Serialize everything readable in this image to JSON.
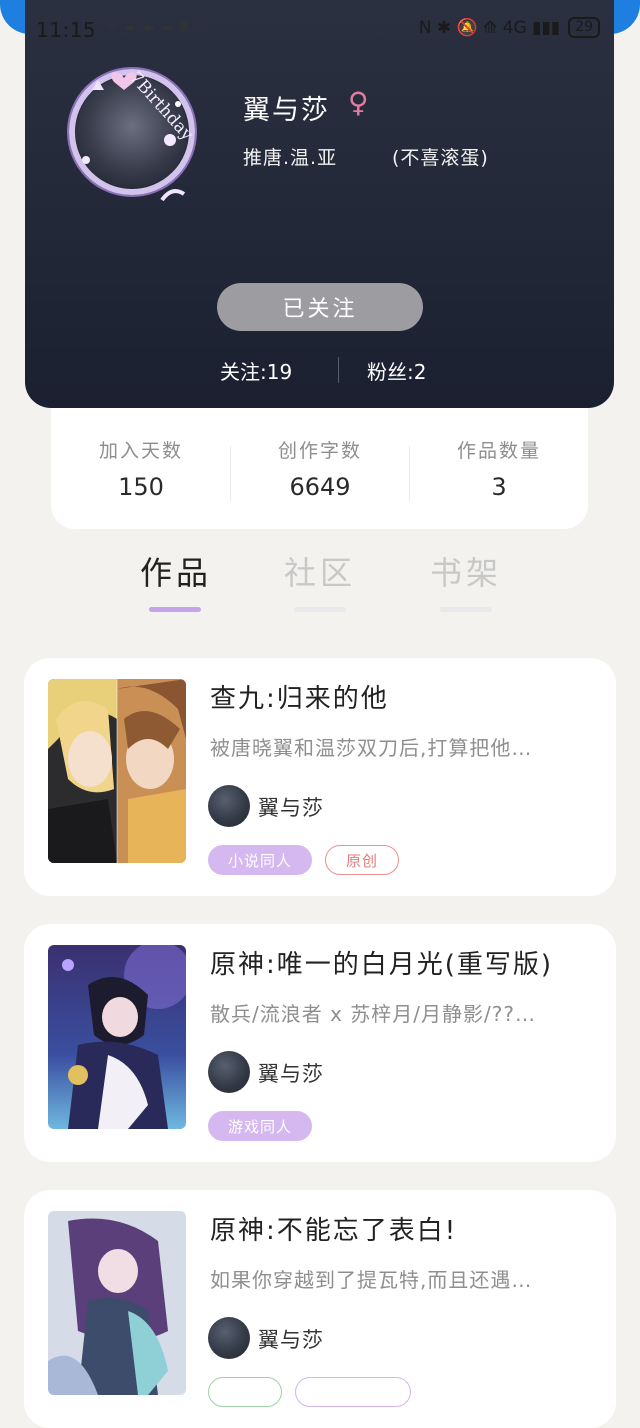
{
  "status_bar": {
    "time": "11:15",
    "notification_icons": "⊖ ☁ ☁ ☁ ▣ …",
    "right_icons": "N ✱ 🔕 ⟰ 4G ▮▮▮",
    "battery": "29"
  },
  "profile": {
    "nickname": "翼与莎",
    "gender_symbol": "♀",
    "bio": "推唐.温.亚",
    "bio_note": "(不喜滚蛋)",
    "avatar_badge_text": "7Birthday",
    "follow_button": "已关注",
    "following": "关注:19",
    "followers": "粉丝:2"
  },
  "stats": [
    {
      "label": "加入天数",
      "value": "150"
    },
    {
      "label": "创作字数",
      "value": "6649"
    },
    {
      "label": "作品数量",
      "value": "3"
    }
  ],
  "tabs": [
    {
      "label": "作品",
      "active": true
    },
    {
      "label": "社区",
      "active": false
    },
    {
      "label": "书架",
      "active": false
    }
  ],
  "works": [
    {
      "title": "查九:归来的他",
      "description": "被唐晓翼和温莎双刀后,打算把他…",
      "author": "翼与莎",
      "tags": [
        "小说同人",
        "原创"
      ]
    },
    {
      "title": "原神:唯一的白月光(重写版)",
      "description": "散兵/流浪者 x 苏梓月/月静影/??…",
      "author": "翼与莎",
      "tags": [
        "游戏同人"
      ]
    },
    {
      "title": "原神:不能忘了表白!",
      "description": "如果你穿越到了提瓦特,而且还遇…",
      "author": "翼与莎",
      "tags": []
    }
  ],
  "colors": {
    "accent": "#c6a4ea",
    "hero_bg": "#222838",
    "tag_outline_red": "#ec8f8f"
  }
}
